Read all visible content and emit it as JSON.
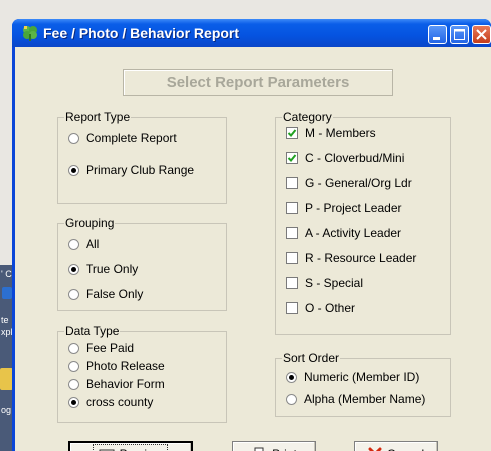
{
  "window": {
    "title": "Fee / Photo / Behavior Report"
  },
  "header_button": "Select Report Parameters",
  "report_type": {
    "legend": "Report Type",
    "options": [
      {
        "label": "Complete Report",
        "checked": false
      },
      {
        "label": "Primary Club Range",
        "checked": true
      }
    ]
  },
  "grouping": {
    "legend": "Grouping",
    "options": [
      {
        "label": "All",
        "checked": false
      },
      {
        "label": "True Only",
        "checked": true
      },
      {
        "label": "False Only",
        "checked": false
      }
    ]
  },
  "data_type": {
    "legend": "Data Type",
    "options": [
      {
        "label": "Fee Paid",
        "checked": false
      },
      {
        "label": "Photo Release",
        "checked": false
      },
      {
        "label": "Behavior Form",
        "checked": false
      },
      {
        "label": "cross county",
        "checked": true
      }
    ]
  },
  "category": {
    "legend": "Category",
    "options": [
      {
        "label": "M - Members",
        "checked": true
      },
      {
        "label": "C - Cloverbud/Mini",
        "checked": true
      },
      {
        "label": "G - General/Org Ldr",
        "checked": false
      },
      {
        "label": "P - Project Leader",
        "checked": false
      },
      {
        "label": "A - Activity Leader",
        "checked": false
      },
      {
        "label": "R - Resource Leader",
        "checked": false
      },
      {
        "label": "S - Special",
        "checked": false
      },
      {
        "label": "O - Other",
        "checked": false
      }
    ]
  },
  "sort_order": {
    "legend": "Sort Order",
    "options": [
      {
        "label": "Numeric (Member ID)",
        "checked": true
      },
      {
        "label": "Alpha (Member Name)",
        "checked": false
      }
    ]
  },
  "buttons": {
    "preview": {
      "mn": "P",
      "rest": "review",
      "label": "Preview"
    },
    "print": {
      "mn": "P",
      "rest": "rint",
      "label": "Print"
    },
    "cancel": {
      "mn": "C",
      "rest": "ancel",
      "label": "Cancel"
    }
  },
  "desktop": {
    "fragments": [
      "' C",
      "te",
      "xpl",
      "og"
    ]
  },
  "colors": {
    "titlebar": "#0553e0",
    "client": "#ece9d8",
    "disabled_text": "#a8a79a",
    "cancel_x": "#d42a10"
  }
}
